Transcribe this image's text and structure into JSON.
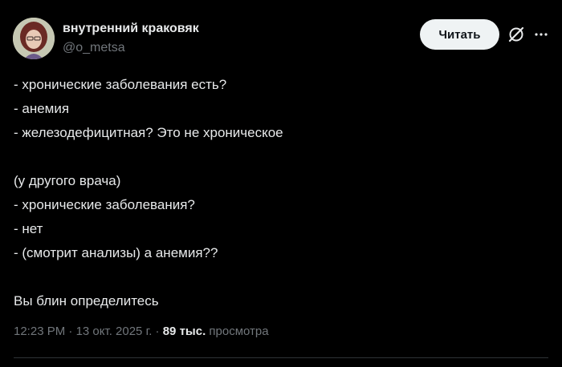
{
  "author": {
    "display_name": "внутренний краковяк",
    "handle": "@o_metsa"
  },
  "actions": {
    "follow_label": "Читать",
    "grok_icon": "grok-icon",
    "more_icon": "more-icon"
  },
  "tweet": {
    "lines": [
      "- хронические заболевания есть?",
      "- анемия",
      "- железодефицитная? Это не хроническое",
      "",
      "(у другого врача)",
      "- хронические заболевания?",
      "- нет",
      "- (смотрит анализы) а анемия??",
      "",
      "Вы блин определитесь"
    ]
  },
  "meta": {
    "time": "12:23 PM",
    "sep1": " · ",
    "date": "13 окт. 2025 г.",
    "sep2": " · ",
    "views_count": "89 тыс.",
    "views_label": " просмотра"
  },
  "colors": {
    "background": "#000000",
    "text": "#e7e9ea",
    "secondary": "#71767b",
    "button_bg": "#eff3f4"
  }
}
